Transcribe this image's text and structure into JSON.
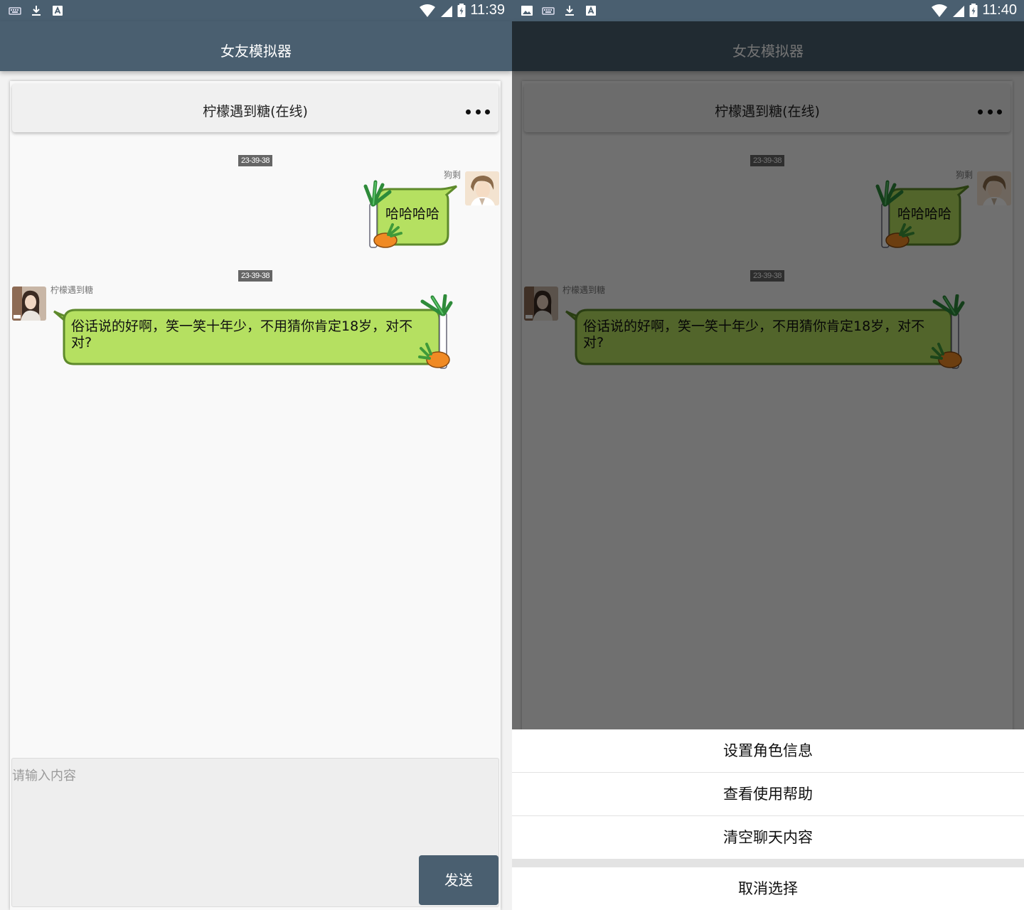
{
  "app": {
    "title": "女友模拟器"
  },
  "chat": {
    "partner_title": "柠檬遇到糖(在线)",
    "messages": [
      {
        "time": "23-39-38",
        "sender": "狗剩",
        "side": "right",
        "text": "哈哈哈哈"
      },
      {
        "time": "23-39-38",
        "sender": "柠檬遇到糖",
        "side": "left",
        "text": "俗话说的好啊，笑一笑十年少，不用猜你肯定18岁，对不对?"
      }
    ]
  },
  "input": {
    "placeholder": "请输入内容",
    "send_label": "发送"
  },
  "status_left": {
    "time": "11:39"
  },
  "status_right": {
    "time": "11:40"
  },
  "sheet": {
    "items": [
      "设置角色信息",
      "查看使用帮助",
      "清空聊天内容"
    ],
    "cancel_label": "取消选择"
  },
  "colors": {
    "primary": "#4a5f70",
    "bubble_green": "#b5e061",
    "bubble_outline": "#5e8a2c"
  },
  "icons": [
    "keyboard-icon",
    "download-icon",
    "app-a-icon",
    "image-icon",
    "wifi-icon",
    "signal-icon",
    "battery-icon",
    "more-dots-icon",
    "leek-icon",
    "carrot-icon"
  ]
}
